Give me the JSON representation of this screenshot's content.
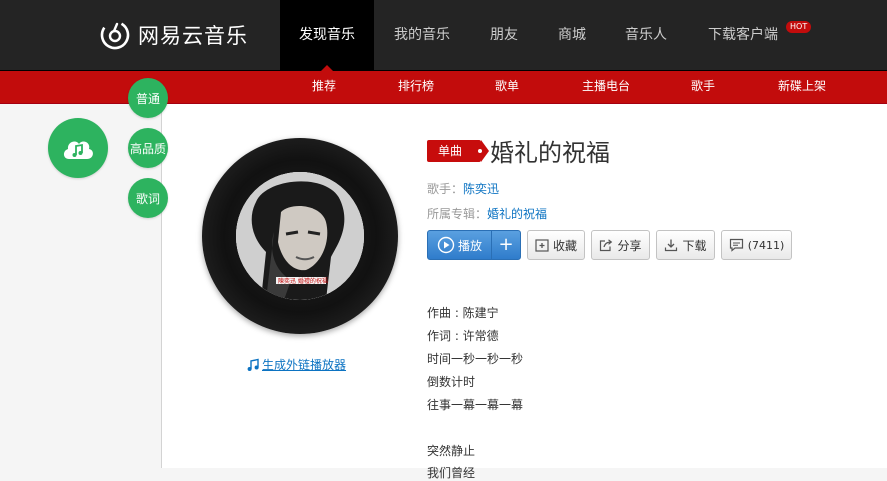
{
  "brand": {
    "name": "网易云音乐",
    "accent": "#c20c0c",
    "green": "#2db35f",
    "blue": "#0c73c2"
  },
  "top_nav": [
    {
      "label": "发现音乐",
      "active": true
    },
    {
      "label": "我的音乐"
    },
    {
      "label": "朋友"
    },
    {
      "label": "商城"
    },
    {
      "label": "音乐人"
    },
    {
      "label": "下载客户端",
      "badge": "HOT"
    }
  ],
  "sub_nav": [
    "推荐",
    "排行榜",
    "歌单",
    "主播电台",
    "歌手",
    "新碟上架"
  ],
  "quality_options": [
    "普通",
    "高品质",
    "歌词"
  ],
  "cloud_icon": "cloud-music-icon",
  "song": {
    "badge": "单曲",
    "title": "婚礼的祝福",
    "artist_label": "歌手：",
    "artist": "陈奕迅",
    "album_label": "所属专辑：",
    "album": "婚礼的祝福",
    "cover_text": "陳奕迅 婚禮的祝福"
  },
  "actions": {
    "play": "播放",
    "add": "+",
    "collect": "收藏",
    "share": "分享",
    "download": "下载",
    "comment": "(7411)"
  },
  "ext_player_link": "生成外链播放器",
  "lyrics": [
    "作曲 : 陈建宁",
    "作词 : 许常德",
    "时间一秒一秒一秒",
    "倒数计时",
    "往事一幕一幕一幕",
    "",
    "突然静止",
    "我们曾经"
  ]
}
